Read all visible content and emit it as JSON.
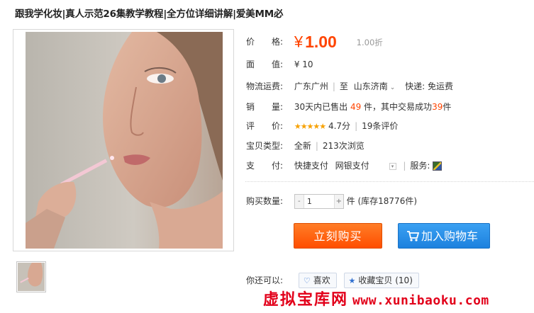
{
  "product": {
    "title": "跟我学化妆|真人示范26集教学教程|全方位详细讲解|爱美MM必"
  },
  "price": {
    "label": "价　　格:",
    "currency": "¥",
    "value": "1.00",
    "discount": "1.00折"
  },
  "face_value": {
    "label": "面　　值:",
    "value": "¥ 10"
  },
  "shipping": {
    "label": "物流运费:",
    "from": "广东广州",
    "to_prefix": "至",
    "to": "山东济南",
    "express": "快递: 免运费"
  },
  "sales": {
    "label": "销　　量:",
    "prefix": "30天内已售出",
    "sold": "49",
    "mid": "件，其中交易成功",
    "success": "39",
    "suffix": "件"
  },
  "rating": {
    "label": "评　　价:",
    "stars": "★★★★★",
    "score": "4.7分",
    "reviews": "19条评价"
  },
  "item_type": {
    "label": "宝贝类型:",
    "condition": "全新",
    "views": "213次浏览"
  },
  "payment": {
    "label": "支　　付:",
    "method1": "快捷支付",
    "method2": "网银支付",
    "caret": "▾",
    "service_label": "服务:"
  },
  "purchase": {
    "label": "购买数量:",
    "minus": "-",
    "quantity": "1",
    "plus": "+",
    "stock": "件 (库存18776件)"
  },
  "actions": {
    "buy_now": "立刻购买",
    "add_to_cart": "加入购物车"
  },
  "extras": {
    "label": "你还可以:",
    "like": "喜欢",
    "favorite": "收藏宝贝 (10)"
  },
  "watermark": {
    "cn": "虚拟宝库网",
    "url": "www.xunibaoku.com"
  },
  "colors": {
    "accent": "#ff4400",
    "buy": "#ff4e00",
    "cart": "#1d81de",
    "watermark": "#e2001a"
  }
}
